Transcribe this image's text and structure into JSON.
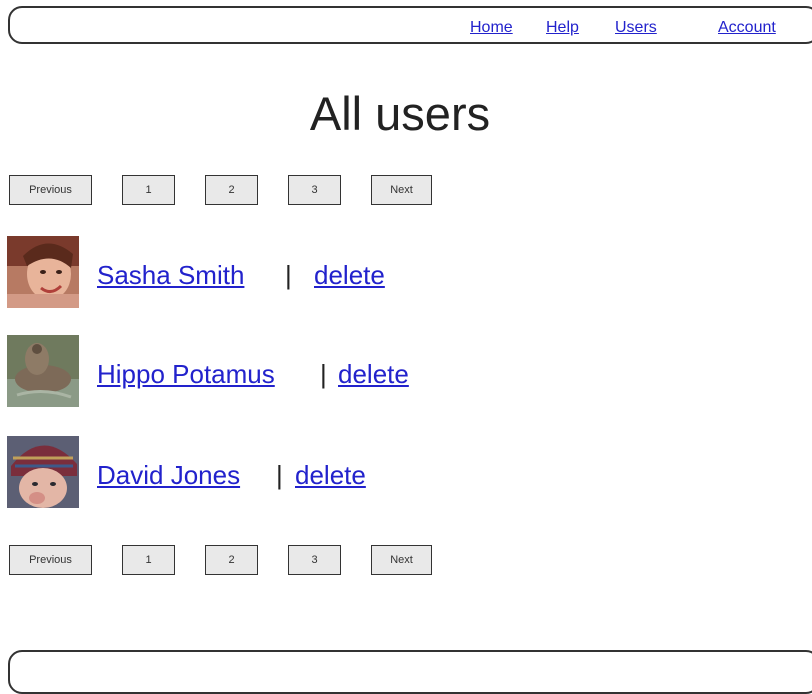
{
  "nav": {
    "home": "Home",
    "help": "Help",
    "users": "Users",
    "account": "Account"
  },
  "page_title": "All users",
  "pagination": {
    "previous": "Previous",
    "pages": [
      "1",
      "2",
      "3"
    ],
    "next": "Next"
  },
  "users": [
    {
      "name": "Sasha Smith",
      "separator": "|",
      "delete_label": "delete",
      "avatar": "avatar-photo-woman"
    },
    {
      "name": "Hippo Potamus",
      "separator": "|",
      "delete_label": "delete",
      "avatar": "avatar-photo-hippo"
    },
    {
      "name": "David Jones",
      "separator": "|",
      "delete_label": "delete",
      "avatar": "avatar-photo-child"
    }
  ],
  "colors": {
    "link": "#2222cc",
    "text": "#222222",
    "button_bg": "#e9e9e9",
    "border": "#333333"
  }
}
